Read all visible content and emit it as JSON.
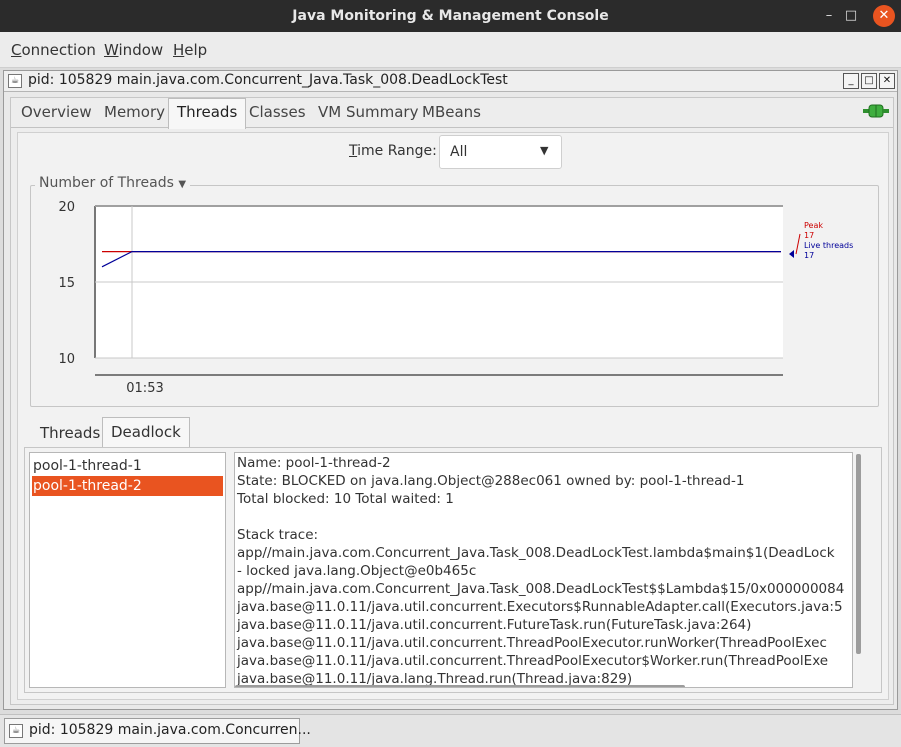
{
  "window": {
    "title": "Java Monitoring & Management Console",
    "min_glyph": "–",
    "max_glyph": "□",
    "close_glyph": "✕"
  },
  "menu": {
    "connection": {
      "accel": "C",
      "rest": "onnection"
    },
    "window": {
      "accel": "W",
      "rest": "indow"
    },
    "help": {
      "accel": "H",
      "rest": "elp"
    }
  },
  "internal_frame": {
    "title": "pid: 105829 main.java.com.Concurrent_Java.Task_008.DeadLockTest",
    "icon_glyph": "☕",
    "btn_min": "_",
    "btn_max": "□",
    "btn_close": "✕"
  },
  "tabs": [
    "Overview",
    "Memory",
    "Threads",
    "Classes",
    "VM Summary",
    "MBeans"
  ],
  "selected_tab": "Threads",
  "time_range": {
    "accel": "T",
    "rest": "ime Range:",
    "value": "All",
    "arrow": "▼"
  },
  "chart_data": {
    "type": "line",
    "title": "Number of Threads",
    "title_arrow": "▼",
    "x_tick_labels": [
      "01:53"
    ],
    "ylim": [
      10,
      20
    ],
    "y_ticks": [
      "20",
      "15",
      "10"
    ],
    "grid": true,
    "legend_position": "right",
    "series": [
      {
        "name": "Peak",
        "color": "#cc0000",
        "last_value": "17",
        "x": [
          "start",
          "01:53",
          "end"
        ],
        "values": [
          17,
          17,
          17
        ]
      },
      {
        "name": "Live threads",
        "color": "#000099",
        "last_value": "17",
        "x": [
          "start",
          "01:53",
          "end"
        ],
        "values": [
          16,
          17,
          17
        ]
      }
    ]
  },
  "sub_tabs": [
    "Threads",
    "Deadlock"
  ],
  "selected_sub_tab": "Deadlock",
  "thread_list": [
    "pool-1-thread-1",
    "pool-1-thread-2"
  ],
  "selected_thread": "pool-1-thread-2",
  "details": [
    "Name: pool-1-thread-2",
    "State: BLOCKED on java.lang.Object@288ec061 owned by: pool-1-thread-1",
    "Total blocked: 10  Total waited: 1",
    "",
    "Stack trace:",
    "app//main.java.com.Concurrent_Java.Task_008.DeadLockTest.lambda$main$1(DeadLock",
    "   - locked java.lang.Object@e0b465c",
    "app//main.java.com.Concurrent_Java.Task_008.DeadLockTest$$Lambda$15/0x000000084",
    "java.base@11.0.11/java.util.concurrent.Executors$RunnableAdapter.call(Executors.java:5",
    "java.base@11.0.11/java.util.concurrent.FutureTask.run(FutureTask.java:264)",
    "java.base@11.0.11/java.util.concurrent.ThreadPoolExecutor.runWorker(ThreadPoolExec",
    "java.base@11.0.11/java.util.concurrent.ThreadPoolExecutor$Worker.run(ThreadPoolExe",
    "java.base@11.0.11/java.lang.Thread.run(Thread.java:829)"
  ],
  "taskbar": {
    "item": "pid: 105829 main.java.com.Concurren..."
  },
  "colors": {
    "accent": "#e95420",
    "peak": "#cc0000",
    "live": "#000099"
  }
}
